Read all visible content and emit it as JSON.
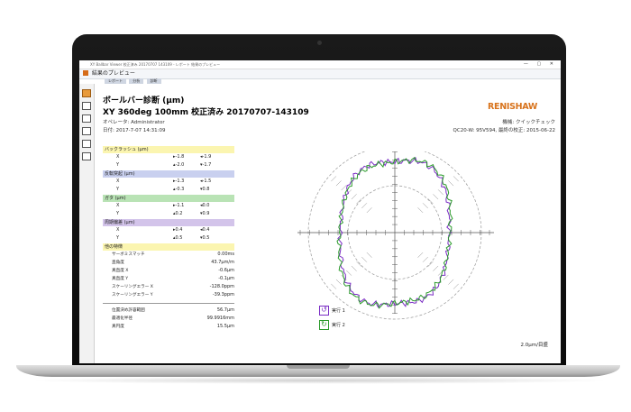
{
  "window": {
    "title_text": "XY Ballbar Viewer 校正済み 20170707 143109 - レポート 結果のプレビュー",
    "controls": "—  ▢  ✕",
    "app_title": "結果のプレビュー",
    "tabs": [
      "レポート",
      "分析",
      "診断"
    ]
  },
  "report": {
    "title": "ボールバー診断 (μm)",
    "subtitle": "XY 360deg 100mm 校正済み 20170707-143109",
    "operator": "オペレータ: Administrator",
    "date": "日付: 2017-7-07 14:31:09",
    "machine": "機械: クイックチェック",
    "device": "QC20-W: 95V594, 最終の校正: 2015-06-22",
    "logo": "RENISHAW"
  },
  "sections": [
    {
      "title": "バックラッシュ (μm)",
      "color": "#fbf5b0",
      "rows": [
        {
          "axis": "X",
          "a": "▸-1.8",
          "b": "◂-1.9"
        },
        {
          "axis": "Y",
          "a": "▴-2.0",
          "b": "▾-1.7"
        }
      ]
    },
    {
      "title": "反転突起 (μm)",
      "color": "#c9d0ef",
      "rows": [
        {
          "axis": "X",
          "a": "▸-1.3",
          "b": "◂-1.5"
        },
        {
          "axis": "Y",
          "a": "▴-0.3",
          "b": "▾0.8"
        }
      ]
    },
    {
      "title": "ガタ (μm)",
      "color": "#b9e3b5",
      "rows": [
        {
          "axis": "X",
          "a": "▸-1.1",
          "b": "◂0.0"
        },
        {
          "axis": "Y",
          "a": "▴0.2",
          "b": "▾0.9"
        }
      ]
    },
    {
      "title": "周期偏差 (μm)",
      "color": "#d3c4ea",
      "rows": [
        {
          "axis": "X",
          "a": "▸0.4",
          "b": "◂0.4"
        },
        {
          "axis": "Y",
          "a": "▴0.5",
          "b": "▾0.5"
        }
      ]
    }
  ],
  "other": {
    "title": "他の特徴",
    "rows": [
      {
        "label": "サーボミスマッチ",
        "value": "0.00ms"
      },
      {
        "label": "直角度",
        "value": "43.7μm/m"
      },
      {
        "label": "真直度 X",
        "value": "-0.6μm"
      },
      {
        "label": "真直度 Y",
        "value": "-0.1μm"
      },
      {
        "label": "スケーリングエラー X",
        "value": "-128.0ppm"
      },
      {
        "label": "スケーリングエラー Y",
        "value": "-39.3ppm"
      }
    ]
  },
  "summary": [
    {
      "label": "位置決め許容範囲",
      "value": "56.7μm"
    },
    {
      "label": "最適化半径",
      "value": "99.9916mm"
    },
    {
      "label": "真円度",
      "value": "15.5μm"
    }
  ],
  "legend": [
    {
      "label": "実行 1",
      "color": "#7a2cc4",
      "icon": "counterclockwise-run-icon",
      "glyph": "↺"
    },
    {
      "label": "実行 2",
      "color": "#2a9a2a",
      "icon": "clockwise-run-icon",
      "glyph": "↻"
    }
  ],
  "scale_label": "2.0μm/目盛",
  "colors": {
    "run1": "#7a2cc4",
    "run2": "#2a9a2a",
    "accent": "#d8731c"
  }
}
